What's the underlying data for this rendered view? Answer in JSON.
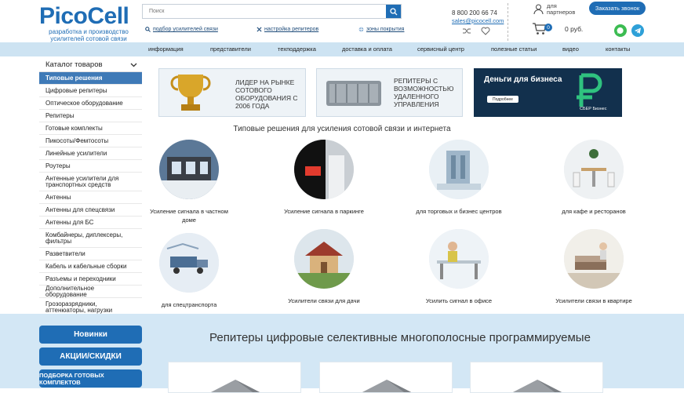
{
  "header": {
    "logo": "PicoCell",
    "tagline": "разработка и производство усилителей сотовой связи",
    "search_placeholder": "Поиск",
    "links": [
      "подбор усилителей связи",
      "настройка репитеров",
      "зоны покрытия"
    ],
    "phone": "8 800 200 66 74",
    "email": "sales@picocell.com",
    "partners": "для партнеров",
    "cart_count": "0",
    "cart_total": "0 руб.",
    "callback": "Заказать звонок"
  },
  "nav": [
    "информация",
    "представители",
    "техподдержка",
    "доставка и оплата",
    "сервисный центр",
    "полезные статьи",
    "видео",
    "контакты"
  ],
  "sidebar": {
    "title": "Каталог товаров",
    "items": [
      "Типовые решения",
      "Цифровые репитеры",
      "Оптическое оборудование",
      "Репитеры",
      "Готовые комплекты",
      "Пикосоты/Фемтосоты",
      "Линейные усилители",
      "Роутеры",
      "Антенные усилители для транспортных средств",
      "Антенны",
      "Антенны для спецсвязи",
      "Антенны для БС",
      "Комбайнеры, диплексеры, фильтры",
      "Разветвители",
      "Кабель и кабельные сборки",
      "Разъемы и переходники",
      "Дополнительное оборудование",
      "Грозоразрядники, аттенюаторы, нагрузки"
    ],
    "buttons": [
      "Новинки",
      "АКЦИИ/СКИДКИ",
      "ПОДБОРКА ГОТОВЫХ КОМПЛЕКТОВ"
    ]
  },
  "banners": [
    {
      "text": "ЛИДЕР НА РЫНКЕ СОТОВОГО ОБОРУДОВАНИЯ С 2006 ГОДА"
    },
    {
      "text": "РЕПИТЕРЫ С ВОЗМОЖНОСТЬЮ УДАЛЕННОГО УПРАВЛЕНИЯ"
    },
    {
      "title": "Деньги для бизнеса",
      "button": "Подробнее",
      "brand": "СБЕР Бизнес"
    }
  ],
  "solutions_title": "Типовые решения для усиления сотовой связи и интернета",
  "solutions": [
    "Усиление сигнала в частном доме",
    "Усиление сигнала в паркинге",
    "для торговых и бизнес центров",
    "для кафе и ресторанов",
    "для спецтранспорта",
    "Усилители связи для дачи",
    "Усилить сигнал в офисе",
    "Усилители связи в квартире"
  ],
  "bottom_title": "Репитеры цифровые селективные многополосные программируемые",
  "colors": {
    "brand": "#1f6db5",
    "nav_bg": "#cde3f2",
    "band_bg": "#d3e7f5",
    "active_item": "#3f7ab7"
  }
}
